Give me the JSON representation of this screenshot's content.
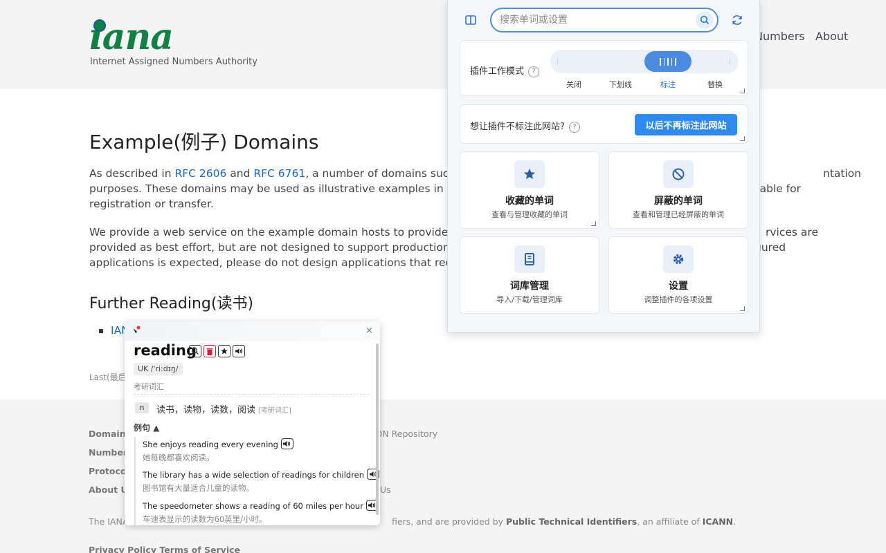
{
  "site": {
    "logo_word": "iana",
    "logo_sub": "Internet Assigned Numbers Authority",
    "nav": {
      "numbers": "Numbers",
      "about": "About"
    }
  },
  "main": {
    "heading": "Example(例子) Domains",
    "p1_a": "As described in ",
    "p1_rfc1": "RFC 2606",
    "p1_b": " and ",
    "p1_rfc2": "RFC 6761",
    "p1_c": ", a number of domains such as",
    "p1_d": "ntation",
    "p1_line2": "purposes. These domains may be used as illustrative examples in doc",
    "p1_line2_end": "ilable for",
    "p1_line3": "registration or transfer.",
    "p2_line1": "We provide a web service on the example domain hosts to provide ba",
    "p2_line1_end": "rvices are",
    "p2_line2": "provided as best effort, but are not designed to support production(生",
    "p2_line2_end": "gured",
    "p2_line3": "applications is expected, please do not design applications that requi",
    "further_heading": "Further Reading(读书)",
    "bullet_link": "IAN",
    "last_updated": "Last(最后"
  },
  "footer": {
    "col1": [
      "Domain",
      "Number",
      "Protocol",
      "About Us"
    ],
    "mid1": "IDN Repository",
    "mid4": "Us",
    "note_pre": "The IANA",
    "note_mid": "fiers, and are provided by ",
    "note_b1": "Public Technical Identifiers",
    "note_mid2": ", an affiliate of ",
    "note_b2": "ICANN",
    "note_end": ".",
    "links": "Privacy Policy   Terms of Service"
  },
  "popup": {
    "search_placeholder": "搜索单词或设置",
    "mode_label": "插件工作模式",
    "mode_options": [
      "关闭",
      "下划线",
      "标注",
      "替换"
    ],
    "mode_selected": "标注",
    "site_label": "想让插件不标注此网站?",
    "site_button": "以后不再标注此网站",
    "qmark": "?",
    "tiles": {
      "fav": {
        "title": "收藏的单词",
        "sub": "查看与管理收藏的单词"
      },
      "blk": {
        "title": "屏蔽的单词",
        "sub": "查看和管理已经屏蔽的单词"
      },
      "lib": {
        "title": "词库管理",
        "sub": "导入/下载/管理词库"
      },
      "set": {
        "title": "设置",
        "sub": "调整插件的各项设置"
      }
    }
  },
  "word_popup": {
    "word": "reading",
    "phonetic": "UK /ˈriːdɪŋ/",
    "tag": "考研词汇",
    "pos": "n",
    "definition": "读书，读物，读数，阅读",
    "definition_tag": "[考研词汇]",
    "examples_heading": "例句 ▲",
    "examples": [
      {
        "en": "She enjoys reading every evening",
        "zh": "她每晚都喜欢阅读。"
      },
      {
        "en": "The library has a wide selection of readings for children",
        "zh": "图书馆有大量适合儿童的读物。"
      },
      {
        "en": "The speedometer shows a reading of 60 miles per hour",
        "zh": "车速表显示的读数为60英里/小时。"
      }
    ],
    "close": "×"
  },
  "colors": {
    "accent": "#2f8af0",
    "link": "#1a68c4",
    "logo_green": "#118044"
  }
}
